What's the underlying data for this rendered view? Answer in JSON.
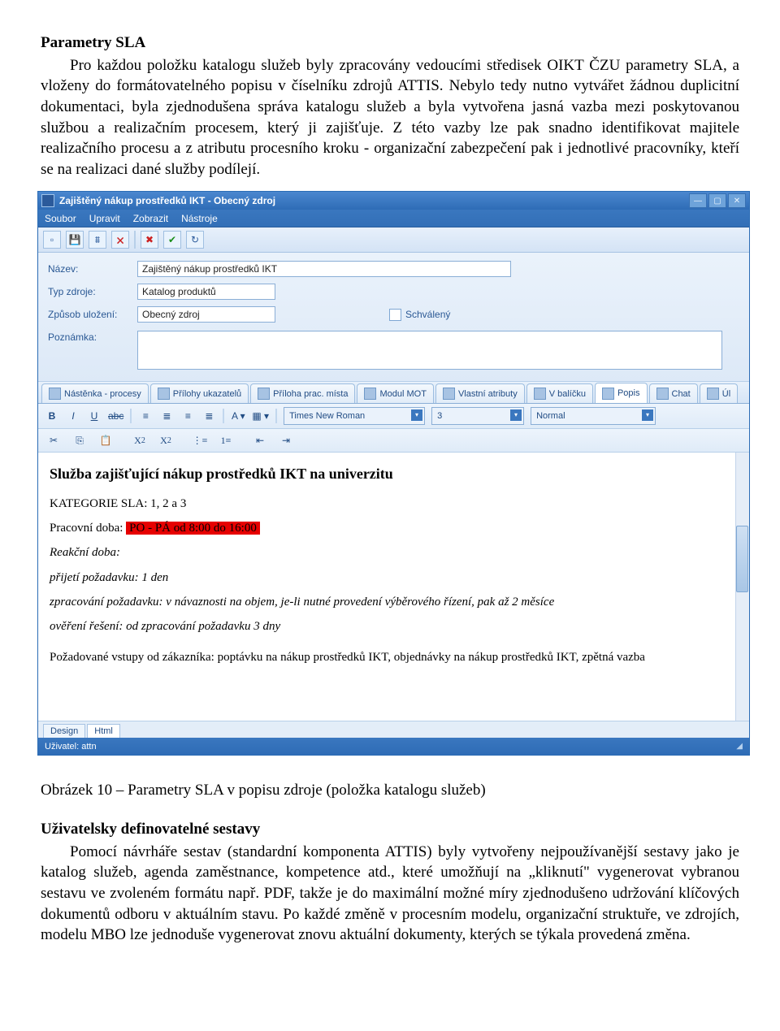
{
  "heading1": "Parametry SLA",
  "para1": "Pro každou položku katalogu služeb byly zpracovány vedoucími středisek OIKT ČZU parametry SLA, a vloženy do formátovatelného popisu v číselníku zdrojů ATTIS. Nebylo tedy nutno vytvářet žádnou duplicitní dokumentaci, byla zjednodušena správa katalogu služeb a byla vytvořena jasná vazba mezi poskytovanou službou a realizačním procesem, který ji zajišťuje. Z této vazby lze pak snadno identifikovat majitele realizačního procesu a z atributu procesního kroku - organizační zabezpečení pak i jednotlivé pracovníky, kteří se na realizaci dané služby podílejí.",
  "window": {
    "title": "Zajištěný nákup prostředků IKT - Obecný zdroj",
    "menu": [
      "Soubor",
      "Upravit",
      "Zobrazit",
      "Nástroje"
    ],
    "form": {
      "l_name": "Název:",
      "v_name": "Zajištěný nákup prostředků IKT",
      "l_type": "Typ zdroje:",
      "v_type": "Katalog produktů",
      "l_store": "Způsob uložení:",
      "v_store": "Obecný zdroj",
      "chk_approved": "Schválený",
      "l_note": "Poznámka:"
    },
    "tabs": [
      "Nástěnka - procesy",
      "Přílohy ukazatelů",
      "Příloha prac. místa",
      "Modul MOT",
      "Vlastní atributy",
      "V balíčku",
      "Popis",
      "Chat",
      "Úl"
    ],
    "rte": {
      "font": "Times New Roman",
      "size": "3",
      "style": "Normal"
    },
    "doc": {
      "h": "Služba zajišťující nákup prostředků IKT na univerzitu",
      "cat": "KATEGORIE SLA: 1, 2 a 3",
      "wh_label": "Pracovní doba: ",
      "wh_val": "PO - PÁ od 8:00 do 16:00",
      "rt_head": "Reakční doba:",
      "rt1": "přijetí požadavku: 1 den",
      "rt2": "zpracování požadavku: v návaznosti na objem, je-li nutné provedení výběrového řízení, pak až 2 měsíce",
      "rt3": "ověření řešení: od zpracování požadavku 3 dny",
      "rt4": "Požadované vstupy od zákazníka: poptávku na nákup prostředků IKT, objednávky na nákup prostředků IKT, zpětná vazba"
    },
    "mini": {
      "design": "Design",
      "html": "Html"
    },
    "status": "Uživatel: attn"
  },
  "caption": "Obrázek 10 – Parametry SLA v popisu zdroje (položka katalogu služeb)",
  "heading2": "Uživatelsky definovatelné sestavy",
  "para2": "Pomocí návrháře sestav (standardní komponenta ATTIS) byly vytvořeny nejpoužívanější sestavy jako je katalog služeb, agenda zaměstnance, kompetence atd., které umožňují na „kliknutí\" vygenerovat vybranou sestavu ve zvoleném formátu např. PDF, takže je do maximální možné míry zjednodušeno udržování klíčových dokumentů odboru v aktuálním stavu. Po každé změně v procesním modelu, organizační struktuře, ve zdrojích, modelu MBO lze jednoduše vygenerovat znovu aktuální dokumenty, kterých se týkala provedená změna."
}
